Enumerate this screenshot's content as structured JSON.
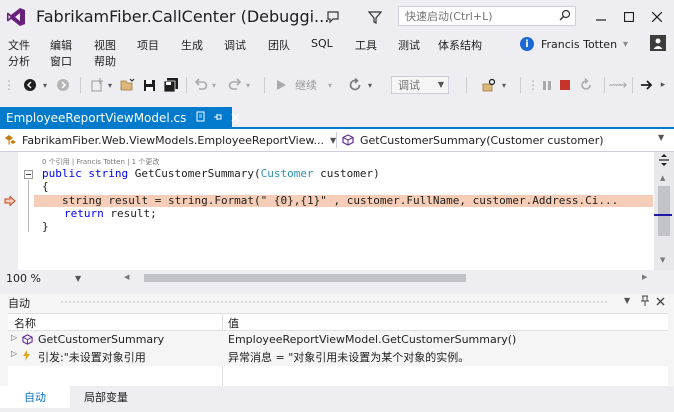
{
  "title": "FabrikamFiber.CallCenter (Debuggi...",
  "quick_launch": {
    "placeholder": "快速启动(Ctrl+L)"
  },
  "menu_row1": [
    "文件",
    "编辑",
    "视图",
    "项目",
    "生成",
    "调试",
    "团队",
    "SQL",
    "工具",
    "测试",
    "体系结构"
  ],
  "menu_row2": [
    "分析",
    "窗口",
    "帮助"
  ],
  "user": {
    "name": "Francis Totten",
    "info_glyph": "i"
  },
  "toolbar": {
    "continue_label": "继续",
    "debug_config": "调试"
  },
  "doc_tab": {
    "label": "EmployeeReportViewModel.cs"
  },
  "nav": {
    "project": "FabrikamFiber.Web.ViewModels.EmployeeReportView...",
    "member": "GetCustomerSummary(Customer customer)"
  },
  "code": {
    "codelens": "0 个引用 | Francis Totten | 1 个更改",
    "sig_public": "public",
    "sig_string": "string",
    "sig_name": " GetCustomerSummary(",
    "sig_type": "Customer",
    "sig_param": " customer)",
    "open_brace": "{",
    "line1": "string result = string.Format(\" {0},{1}\" , customer.FullName, customer.Address.Ci...",
    "line2_kw": "return",
    "line2_rest": " result;",
    "close_brace": "}"
  },
  "zoom": "100 %",
  "autos": {
    "title": "自动",
    "col_name": "名称",
    "col_value": "值",
    "rows": [
      {
        "name": "GetCustomerSummary",
        "value": "EmployeeReportViewModel.GetCustomerSummary()"
      },
      {
        "name": "引发:\"未设置对象引用",
        "value": "异常消息 = \"对象引用未设置为某个对象的实例。"
      }
    ]
  },
  "bottom_tabs": [
    "自动",
    "局部变量"
  ],
  "colors": {
    "accent": "#007acc",
    "vs_purple": "#68217a",
    "highlight": "#f6cdb6",
    "stop_red": "#c5342a"
  }
}
